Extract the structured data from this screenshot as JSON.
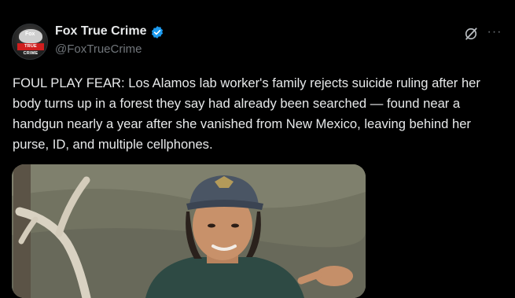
{
  "account": {
    "display_name": "Fox True Crime",
    "handle": "@FoxTrueCrime",
    "avatar_brand": "Fox",
    "avatar_badge": "TRUE CRIME",
    "verified_color": "#1d9bf0"
  },
  "tweet": {
    "text": "FOUL PLAY FEAR: Los Alamos lab worker's family rejects suicide ruling after her body turns up in a forest they say had already been searched — found near a handgun nearly a year after she vanished from New Mexico, leaving behind her purse, ID, and multiple cellphones."
  },
  "actions": {
    "grok_icon": "grok-slash-circle",
    "more_label": "···"
  },
  "media": {
    "description_icon": "photo"
  },
  "colors": {
    "background": "#000000",
    "text_primary": "#e7e9ea",
    "text_secondary": "#71767b"
  }
}
